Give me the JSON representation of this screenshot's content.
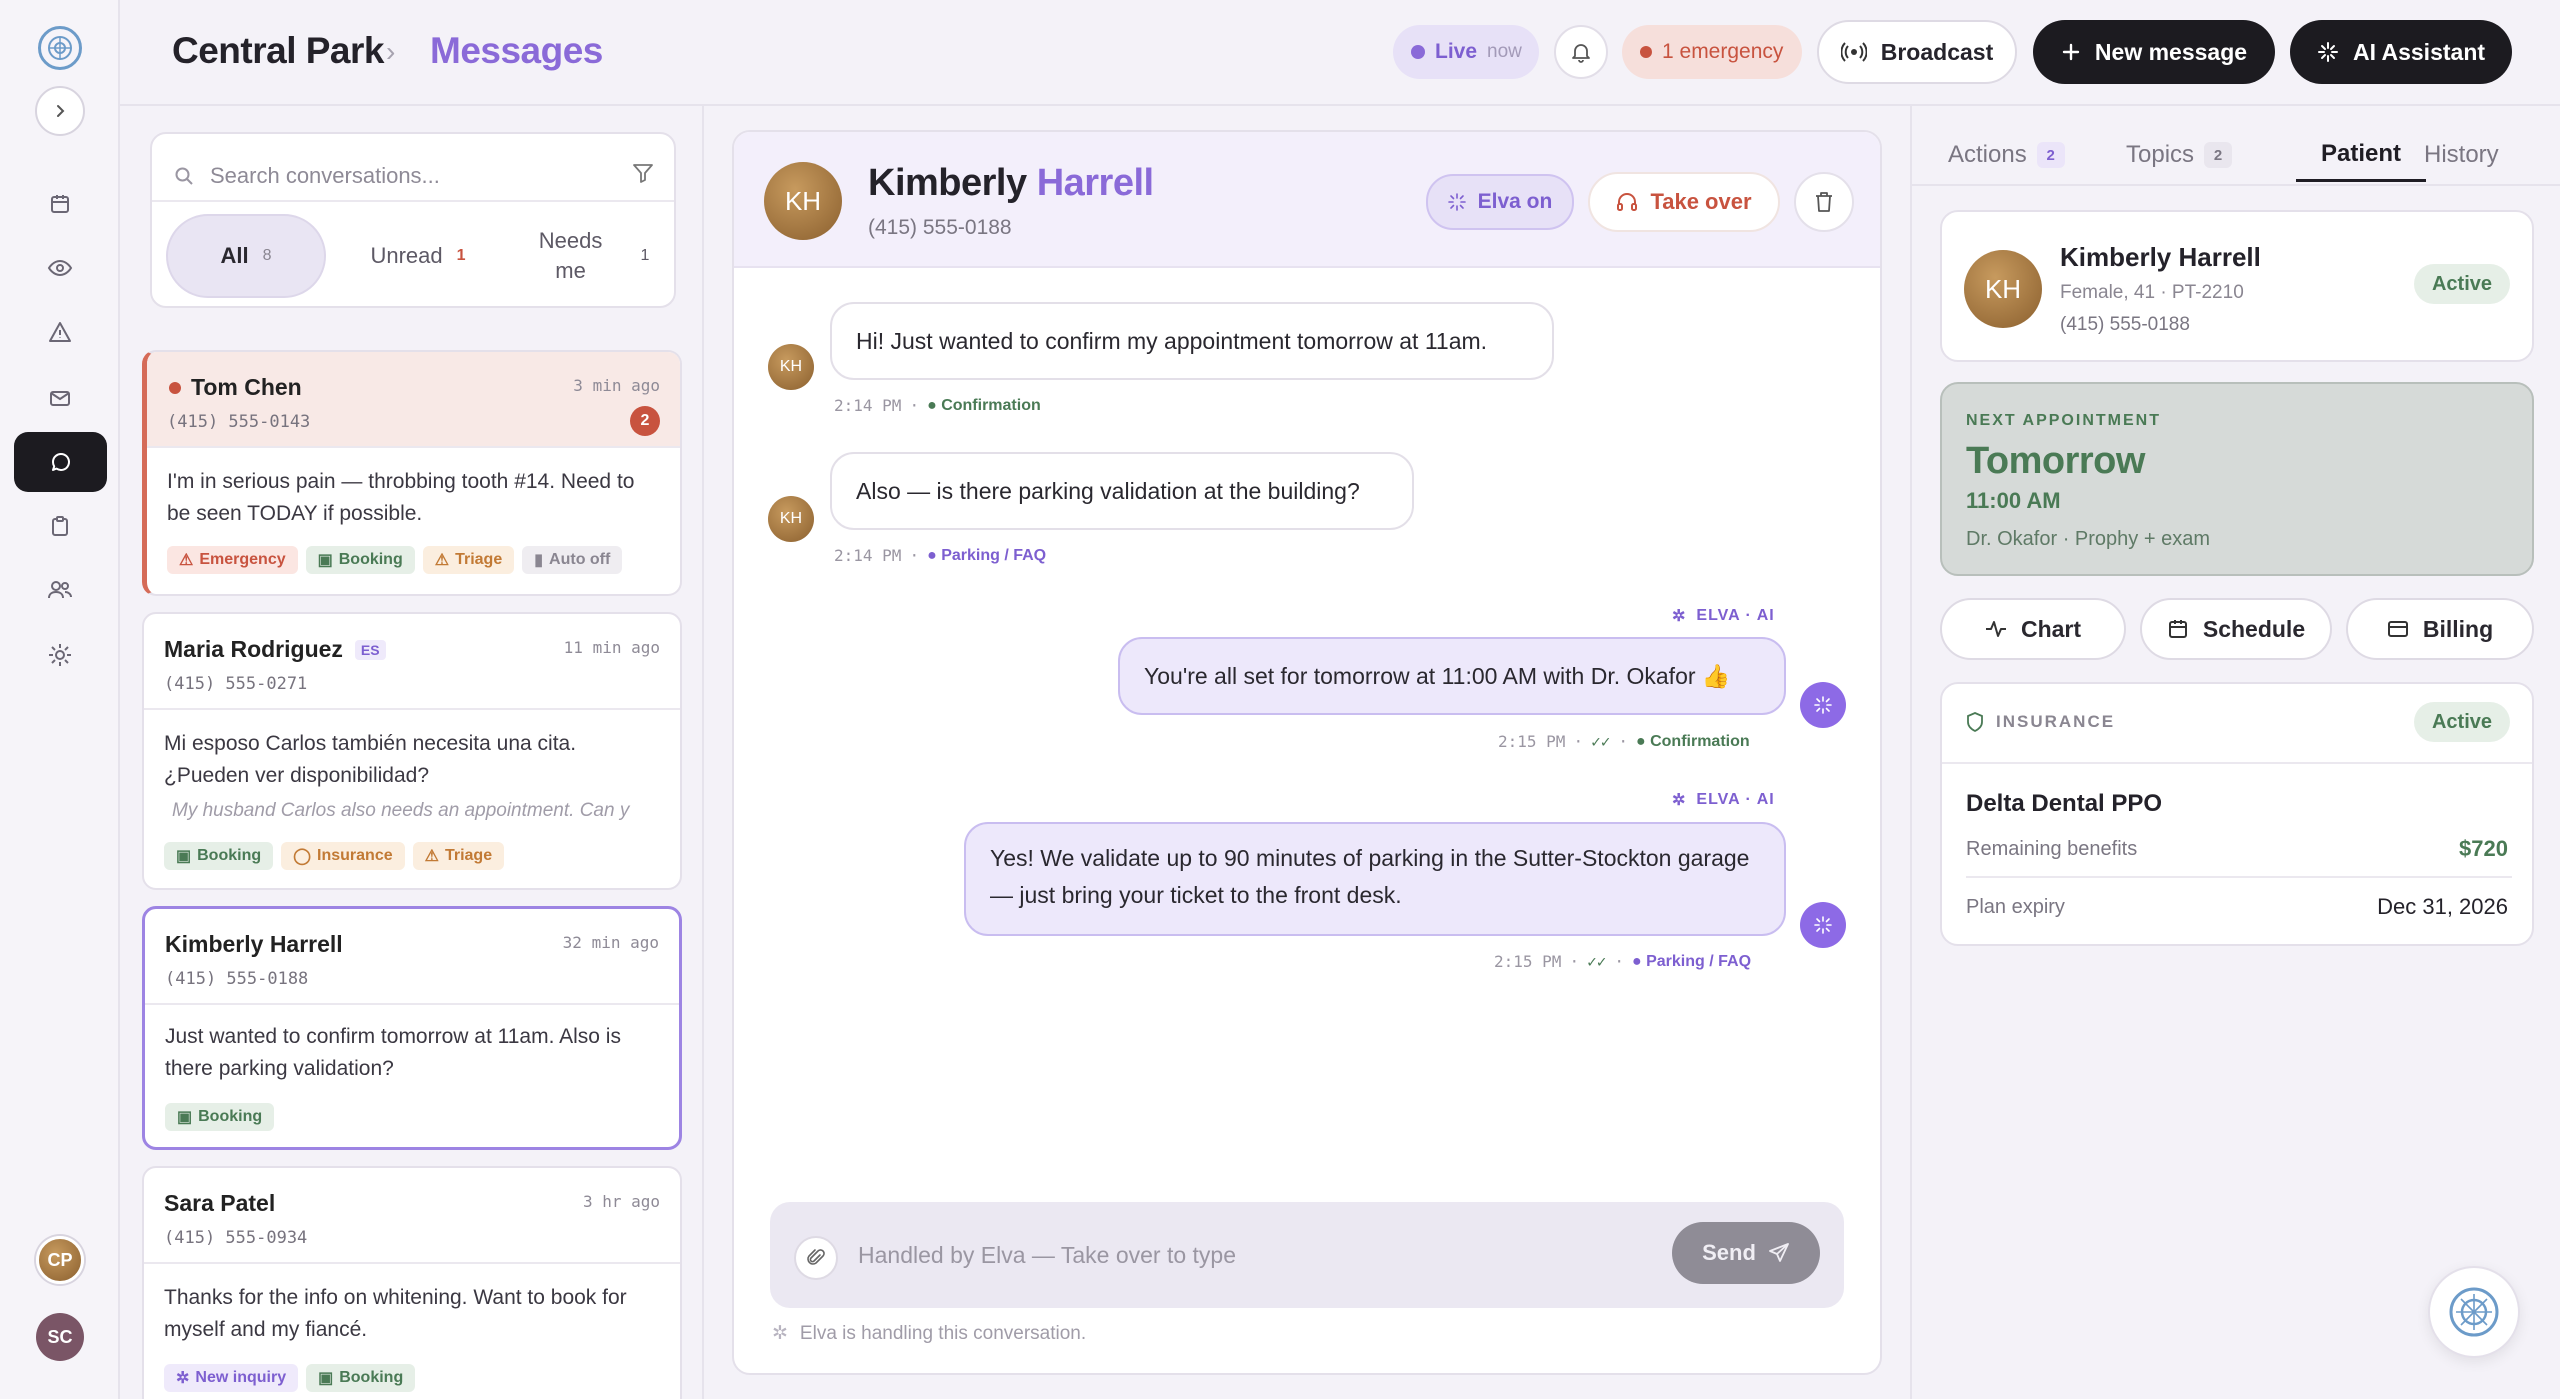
{
  "header": {
    "breadcrumb_root": "Central Park",
    "breadcrumb_sep": "›",
    "breadcrumb_current": "Messages",
    "live_label": "Live",
    "live_time": "now",
    "emergency_label": "1 emergency",
    "broadcast_label": "Broadcast",
    "new_message_label": "New message",
    "ai_assistant_label": "AI Assistant"
  },
  "rail": {
    "avatar_cp": "CP",
    "avatar_sc": "SC"
  },
  "list": {
    "search_placeholder": "Search conversations...",
    "filters": [
      {
        "label": "All",
        "count": "8"
      },
      {
        "label": "Unread",
        "count": "1"
      },
      {
        "label": "Needs me",
        "count": "1"
      }
    ],
    "conversations": [
      {
        "name": "Tom Chen",
        "phone": "(415) 555-0143",
        "time": "3 min ago",
        "unread": "2",
        "preview": "I'm in serious pain — throbbing tooth #14. Need to be seen TODAY if possible.",
        "tags": [
          "Emergency",
          "Booking",
          "Triage",
          "Auto off"
        ]
      },
      {
        "name": "Maria Rodriguez",
        "lang": "ES",
        "phone": "(415) 555-0271",
        "time": "11 min ago",
        "preview": "Mi esposo Carlos también necesita una cita. ¿Pueden ver disponibilidad?",
        "translation": "My husband Carlos also needs an appointment. Can y",
        "tags": [
          "Booking",
          "Insurance",
          "Triage"
        ]
      },
      {
        "name": "Kimberly Harrell",
        "phone": "(415) 555-0188",
        "time": "32 min ago",
        "preview": "Just wanted to confirm tomorrow at 11am. Also is there parking validation?",
        "tags": [
          "Booking"
        ]
      },
      {
        "name": "Sara Patel",
        "phone": "(415) 555-0934",
        "time": "3 hr ago",
        "preview": "Thanks for the info on whitening. Want to book for myself and my fiancé.",
        "tags": [
          "New inquiry",
          "Booking"
        ]
      }
    ]
  },
  "chat": {
    "initials": "KH",
    "first_name": "Kimberly",
    "last_name": "Harrell",
    "phone": "(415) 555-0188",
    "elva_on_label": "Elva on",
    "take_over_label": "Take over",
    "messages": [
      {
        "text": "Hi! Just wanted to confirm my appointment tomorrow at 11am.",
        "time": "2:14 PM",
        "topic": "Confirmation"
      },
      {
        "text": "Also — is there parking validation at the building?",
        "time": "2:14 PM",
        "topic": "Parking / FAQ"
      },
      {
        "sender": "ELVA · AI",
        "text": "You're all set for tomorrow at 11:00 AM with Dr. Okafor 👍",
        "time": "2:15 PM",
        "topic": "Confirmation"
      },
      {
        "sender": "ELVA · AI",
        "text": "Yes! We validate up to 90 minutes of parking in the Sutter-Stockton garage — just bring your ticket to the front desk.",
        "time": "2:15 PM",
        "topic": "Parking / FAQ"
      }
    ],
    "composer_placeholder": "Handled by Elva — Take over to type",
    "send_label": "Send",
    "footer_note": "Elva is handling this conversation."
  },
  "right": {
    "tabs": [
      {
        "label": "Actions",
        "count": "2"
      },
      {
        "label": "Topics",
        "count": "2"
      },
      {
        "label": "Patient",
        "count": ""
      },
      {
        "label": "History",
        "count": ""
      }
    ],
    "patient": {
      "initials": "KH",
      "name": "Kimberly Harrell",
      "details": "Female, 41 · PT-2210",
      "phone": "(415) 555-0188",
      "status": "Active"
    },
    "appointment": {
      "heading": "NEXT APPOINTMENT",
      "day": "Tomorrow",
      "time": "11:00 AM",
      "details": "Dr. Okafor · Prophy + exam"
    },
    "quick_actions": [
      "Chart",
      "Schedule",
      "Billing"
    ],
    "insurance": {
      "heading": "INSURANCE",
      "status": "Active",
      "plan": "Delta Dental PPO",
      "benefits_label": "Remaining benefits",
      "benefits_value": "$720",
      "expiry_label": "Plan expiry",
      "expiry_value": "Dec 31, 2026"
    }
  },
  "colors": {
    "accent": "#8a6ad8",
    "dark": "#1c1b20",
    "emergency": "#c8533f",
    "success": "#4a7a55",
    "appointment_bg": "#d6dad8"
  }
}
